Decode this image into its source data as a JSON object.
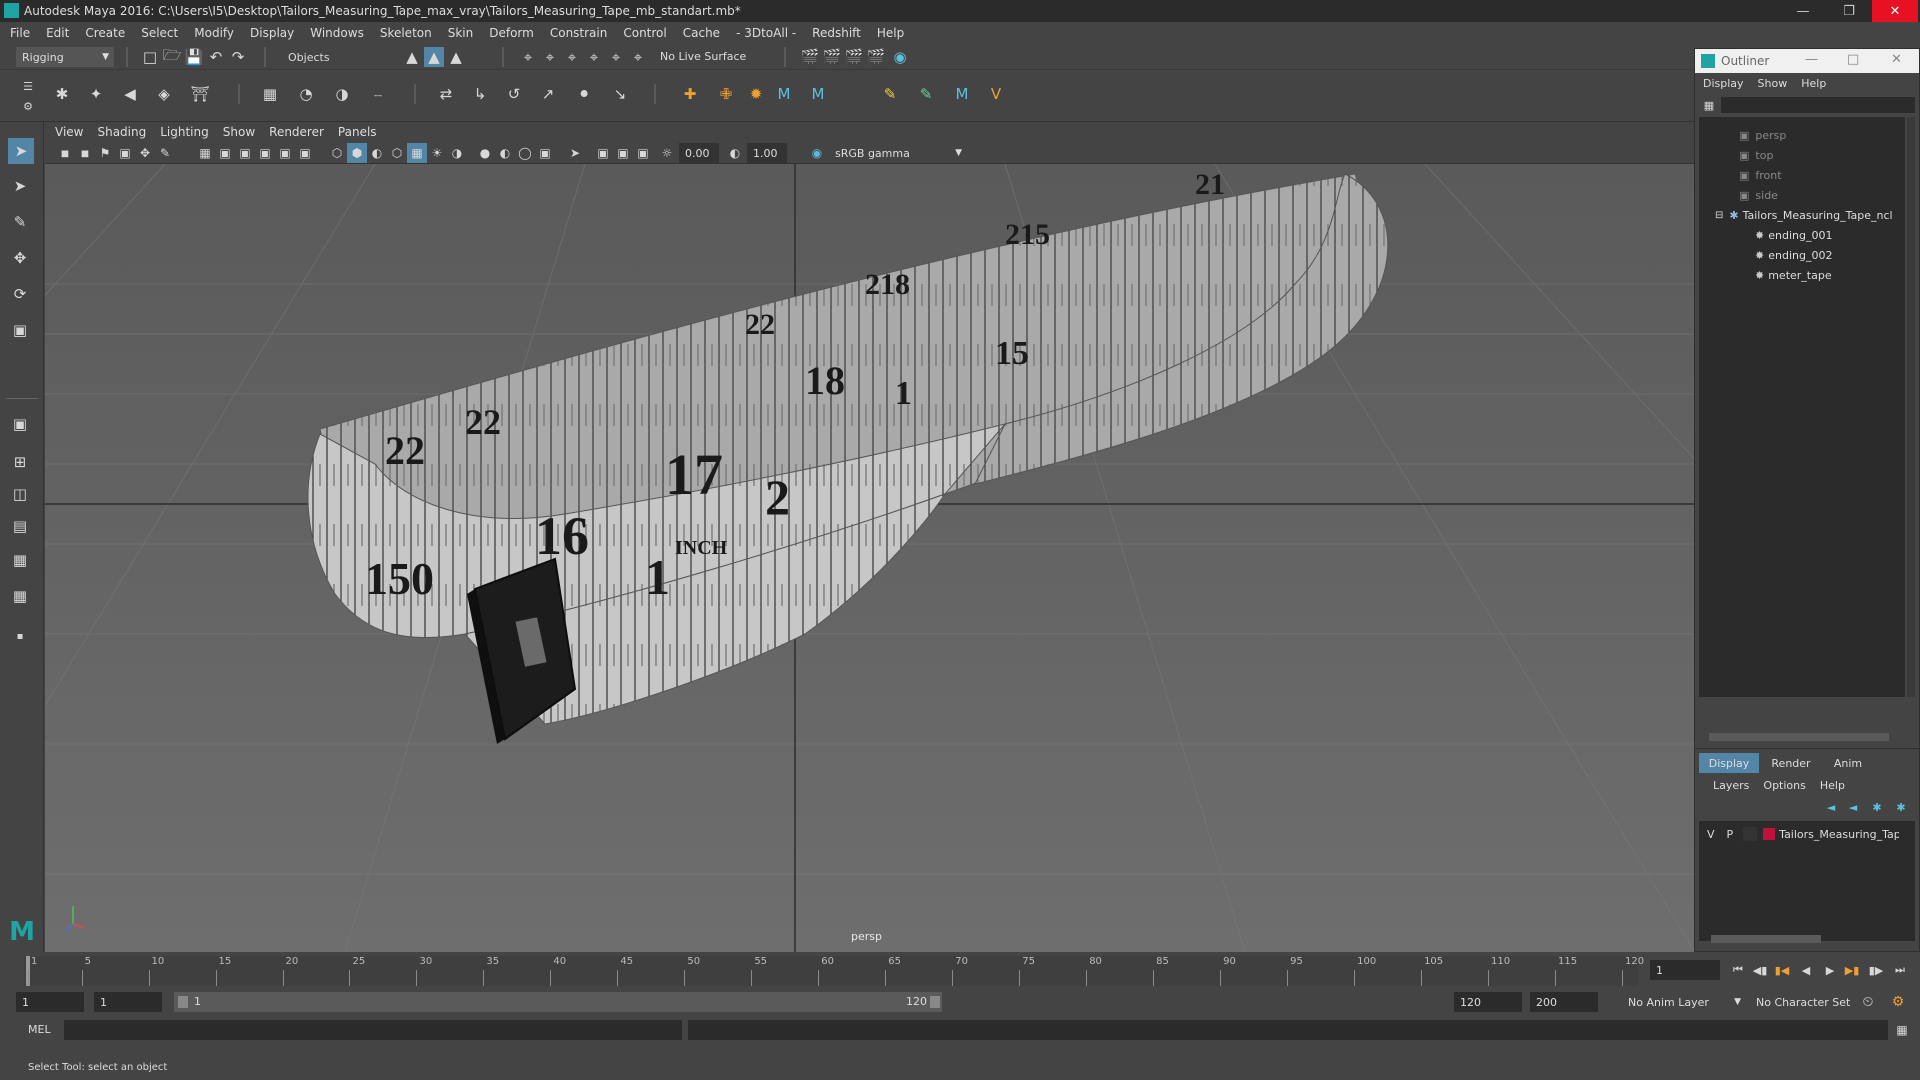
{
  "title_bar": {
    "title": "Autodesk Maya 2016: C:\\Users\\I5\\Desktop\\Tailors_Measuring_Tape_max_vray\\Tailors_Measuring_Tape_mb_standart.mb*"
  },
  "menu": [
    "File",
    "Edit",
    "Create",
    "Select",
    "Modify",
    "Display",
    "Windows",
    "Skeleton",
    "Skin",
    "Deform",
    "Constrain",
    "Control",
    "Cache",
    "- 3DtoAll -",
    "Redshift",
    "Help"
  ],
  "toolbar": {
    "mode": "Rigging",
    "objects": "Objects",
    "live_surface": "No Live Surface"
  },
  "viewport_menu": [
    "View",
    "Shading",
    "Lighting",
    "Show",
    "Renderer",
    "Panels"
  ],
  "viewport_toolbar": {
    "exposure": "0.00",
    "gamma": "1.00",
    "color_space": "sRGB gamma"
  },
  "viewport": {
    "camera_label": "persp"
  },
  "outliner": {
    "title": "Outliner",
    "menu": [
      "Display",
      "Show",
      "Help"
    ],
    "cameras": [
      "persp",
      "top",
      "front",
      "side"
    ],
    "root": "Tailors_Measuring_Tape_ncl",
    "children": [
      "ending_001",
      "ending_002",
      "meter_tape"
    ]
  },
  "layer_panel": {
    "tabs": [
      "Display",
      "Render",
      "Anim"
    ],
    "menu": [
      "Layers",
      "Options",
      "Help"
    ],
    "layer": {
      "v": "V",
      "p": "P",
      "name": "Tailors_Measuring_Tap",
      "color": "#c0103c"
    }
  },
  "timeline": {
    "ticks": [
      "1",
      "5",
      "10",
      "15",
      "20",
      "25",
      "30",
      "35",
      "40",
      "45",
      "50",
      "55",
      "60",
      "65",
      "70",
      "75",
      "80",
      "85",
      "90",
      "95",
      "100",
      "105",
      "110",
      "115",
      "120"
    ],
    "current_frame": "1"
  },
  "range": {
    "start": "1",
    "start_inner": "1",
    "slider_start": "1",
    "slider_end": "120",
    "end_inner": "120",
    "end": "200",
    "anim_layer": "No Anim Layer",
    "character_set": "No Character Set"
  },
  "command": {
    "label": "MEL"
  },
  "help_line": "Select Tool: select an object",
  "colors": {
    "accent": "#5285a6",
    "layer_color": "#c0103c"
  }
}
